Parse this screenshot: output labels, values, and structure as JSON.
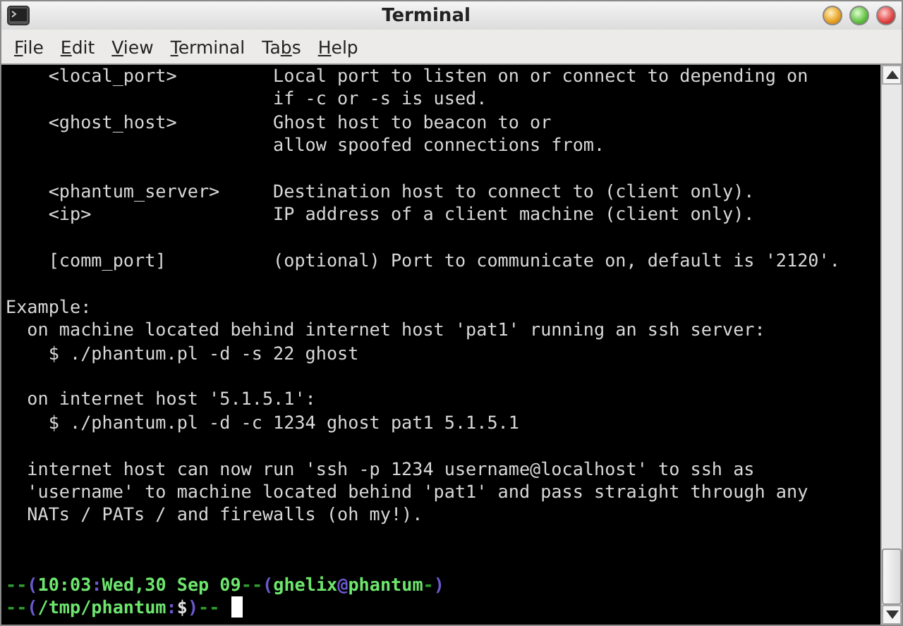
{
  "window": {
    "title": "Terminal"
  },
  "menu": [
    {
      "mnemonic": "F",
      "after": "ile"
    },
    {
      "mnemonic": "E",
      "after": "dit"
    },
    {
      "mnemonic": "V",
      "after": "iew"
    },
    {
      "mnemonic": "T",
      "after": "erminal"
    },
    {
      "before": "Ta",
      "mnemonic": "b",
      "after": "s"
    },
    {
      "mnemonic": "H",
      "after": "elp"
    }
  ],
  "terminal": {
    "lines": [
      {
        "kind": "text",
        "text": "    <local_port>         Local port to listen on or connect to depending on"
      },
      {
        "kind": "text",
        "text": "                         if -c or -s is used."
      },
      {
        "kind": "text",
        "text": "    <ghost_host>         Ghost host to beacon to or"
      },
      {
        "kind": "text",
        "text": "                         allow spoofed connections from."
      },
      {
        "kind": "blank"
      },
      {
        "kind": "text",
        "text": "    <phantum_server>     Destination host to connect to (client only)."
      },
      {
        "kind": "text",
        "text": "    <ip>                 IP address of a client machine (client only)."
      },
      {
        "kind": "blank"
      },
      {
        "kind": "text",
        "text": "    [comm_port]          (optional) Port to communicate on, default is '2120'."
      },
      {
        "kind": "blank"
      },
      {
        "kind": "text",
        "text": "Example:"
      },
      {
        "kind": "text",
        "text": "  on machine located behind internet host 'pat1' running an ssh server:"
      },
      {
        "kind": "text",
        "text": "    $ ./phantum.pl -d -s 22 ghost"
      },
      {
        "kind": "blank"
      },
      {
        "kind": "text",
        "text": "  on internet host '5.1.5.1':"
      },
      {
        "kind": "text",
        "text": "    $ ./phantum.pl -d -c 1234 ghost pat1 5.1.5.1"
      },
      {
        "kind": "blank"
      },
      {
        "kind": "text",
        "text": "  internet host can now run 'ssh -p 1234 username@localhost' to ssh as"
      },
      {
        "kind": "text",
        "text": "  'username' to machine located behind 'pat1' and pass straight through any"
      },
      {
        "kind": "text",
        "text": "  NATs / PATs / and firewalls (oh my!)."
      },
      {
        "kind": "blank"
      },
      {
        "kind": "blank"
      },
      {
        "kind": "prompt",
        "segments": [
          {
            "text": "--",
            "color": "#2f9a2f"
          },
          {
            "text": "(",
            "color": "#6a5acd"
          },
          {
            "text": "10:03",
            "color": "#6ee66e"
          },
          {
            "text": ":",
            "color": "#6a5acd"
          },
          {
            "text": "Wed,30 Sep 09",
            "color": "#6ee66e"
          },
          {
            "text": "--",
            "color": "#2f9a2f"
          },
          {
            "text": "(",
            "color": "#6a5acd"
          },
          {
            "text": "ghelix",
            "color": "#6ee66e"
          },
          {
            "text": "@",
            "color": "#6a5acd"
          },
          {
            "text": "phantum",
            "color": "#6ee66e"
          },
          {
            "text": "-",
            "color": "#2f9a2f"
          },
          {
            "text": ")",
            "color": "#6a5acd"
          }
        ]
      },
      {
        "kind": "prompt",
        "cursor": true,
        "segments": [
          {
            "text": "--",
            "color": "#2f9a2f"
          },
          {
            "text": "(",
            "color": "#6a5acd"
          },
          {
            "text": "/tmp/phantum",
            "color": "#6ee66e"
          },
          {
            "text": ":",
            "color": "#6a5acd"
          },
          {
            "text": "$",
            "color": "#e0e0e0"
          },
          {
            "text": ")",
            "color": "#6a5acd"
          },
          {
            "text": "--",
            "color": "#2f9a2f"
          }
        ]
      }
    ]
  }
}
